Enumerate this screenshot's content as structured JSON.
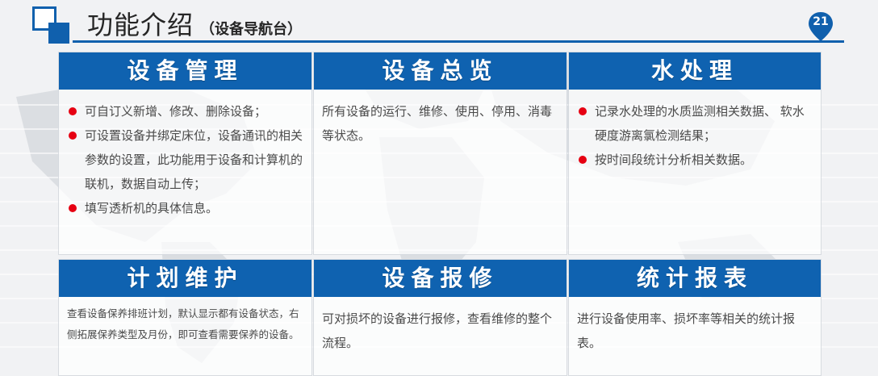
{
  "header": {
    "title": "功能介绍",
    "subtitle": "（设备导航台）",
    "page_number": "21"
  },
  "colors": {
    "primary_blue": "#1060ad",
    "panel_header_blue": "#0f62b0",
    "bullet_red": "#e60012",
    "body_text": "#4a4a4a"
  },
  "panels": {
    "p0": {
      "title": "设备管理",
      "bullets": [
        "可自订义新增、修改、删除设备；",
        "可设置设备并绑定床位，设备通讯的相关参数的设置，此功能用于设备和计算机的联机，数据自动上传；",
        "填写透析机的具体信息。"
      ]
    },
    "p1": {
      "title": "设备总览",
      "text": "所有设备的运行、维修、使用、停用、消毒等状态。"
    },
    "p2": {
      "title": "水处理",
      "bullets": [
        "记录水处理的水质监测相关数据、 软水硬度游离氯检测结果；",
        "按时间段统计分析相关数据。"
      ]
    },
    "p3": {
      "title": "计划维护",
      "text": "查看设备保养排班计划，默认显示都有设备状态，右侧拓展保养类型及月份，即可查看需要保养的设备。"
    },
    "p4": {
      "title": "设备报修",
      "text": "可对损坏的设备进行报修，查看维修的整个流程。"
    },
    "p5": {
      "title": "统计报表",
      "text": "进行设备使用率、损坏率等相关的统计报表。"
    }
  }
}
